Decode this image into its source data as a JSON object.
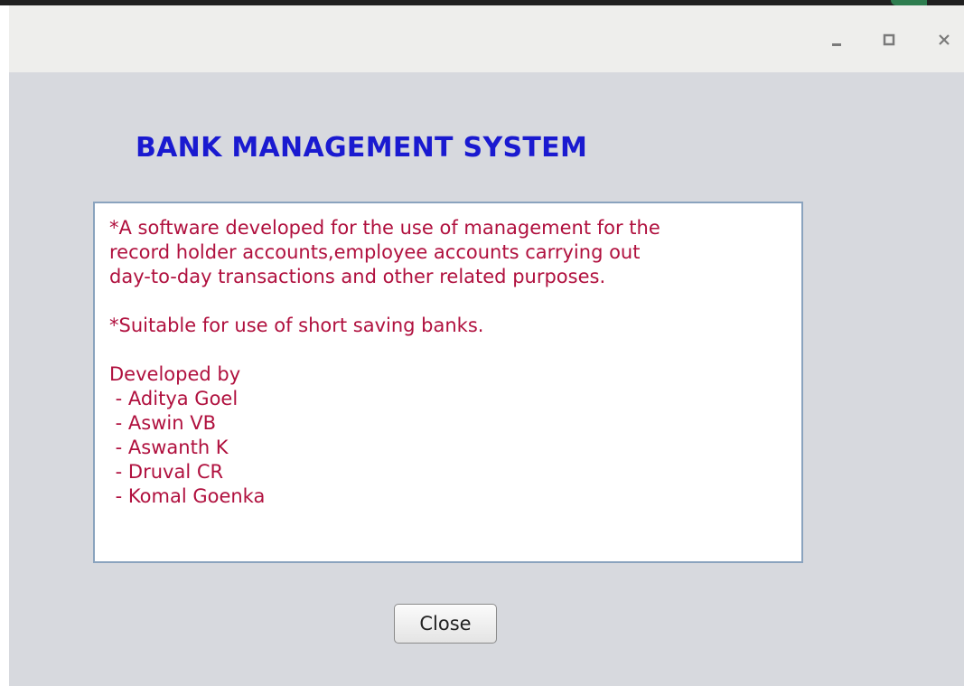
{
  "window": {
    "controls": {
      "minimize_icon": "minimize-icon",
      "maximize_icon": "maximize-icon",
      "close_icon": "close-icon"
    }
  },
  "header": {
    "title": "BANK MANAGEMENT SYSTEM"
  },
  "description": {
    "paragraph1_lines": [
      "*A software developed for the use of management for the",
      "record holder accounts,employee accounts carrying out",
      "day-to-day transactions and other related purposes."
    ],
    "paragraph2": "*Suitable for use of short saving banks.",
    "developed_by_label": "Developed by",
    "developers": [
      " - Aditya Goel",
      " - Aswin VB",
      " - Aswanth K",
      " - Druval CR",
      " - Komal Goenka"
    ]
  },
  "actions": {
    "close_label": "Close"
  },
  "colors": {
    "title": "#1a1ad0",
    "body_text": "#b0103e",
    "window_bg": "#d7d9de",
    "titlebar_bg": "#eeeeec"
  }
}
